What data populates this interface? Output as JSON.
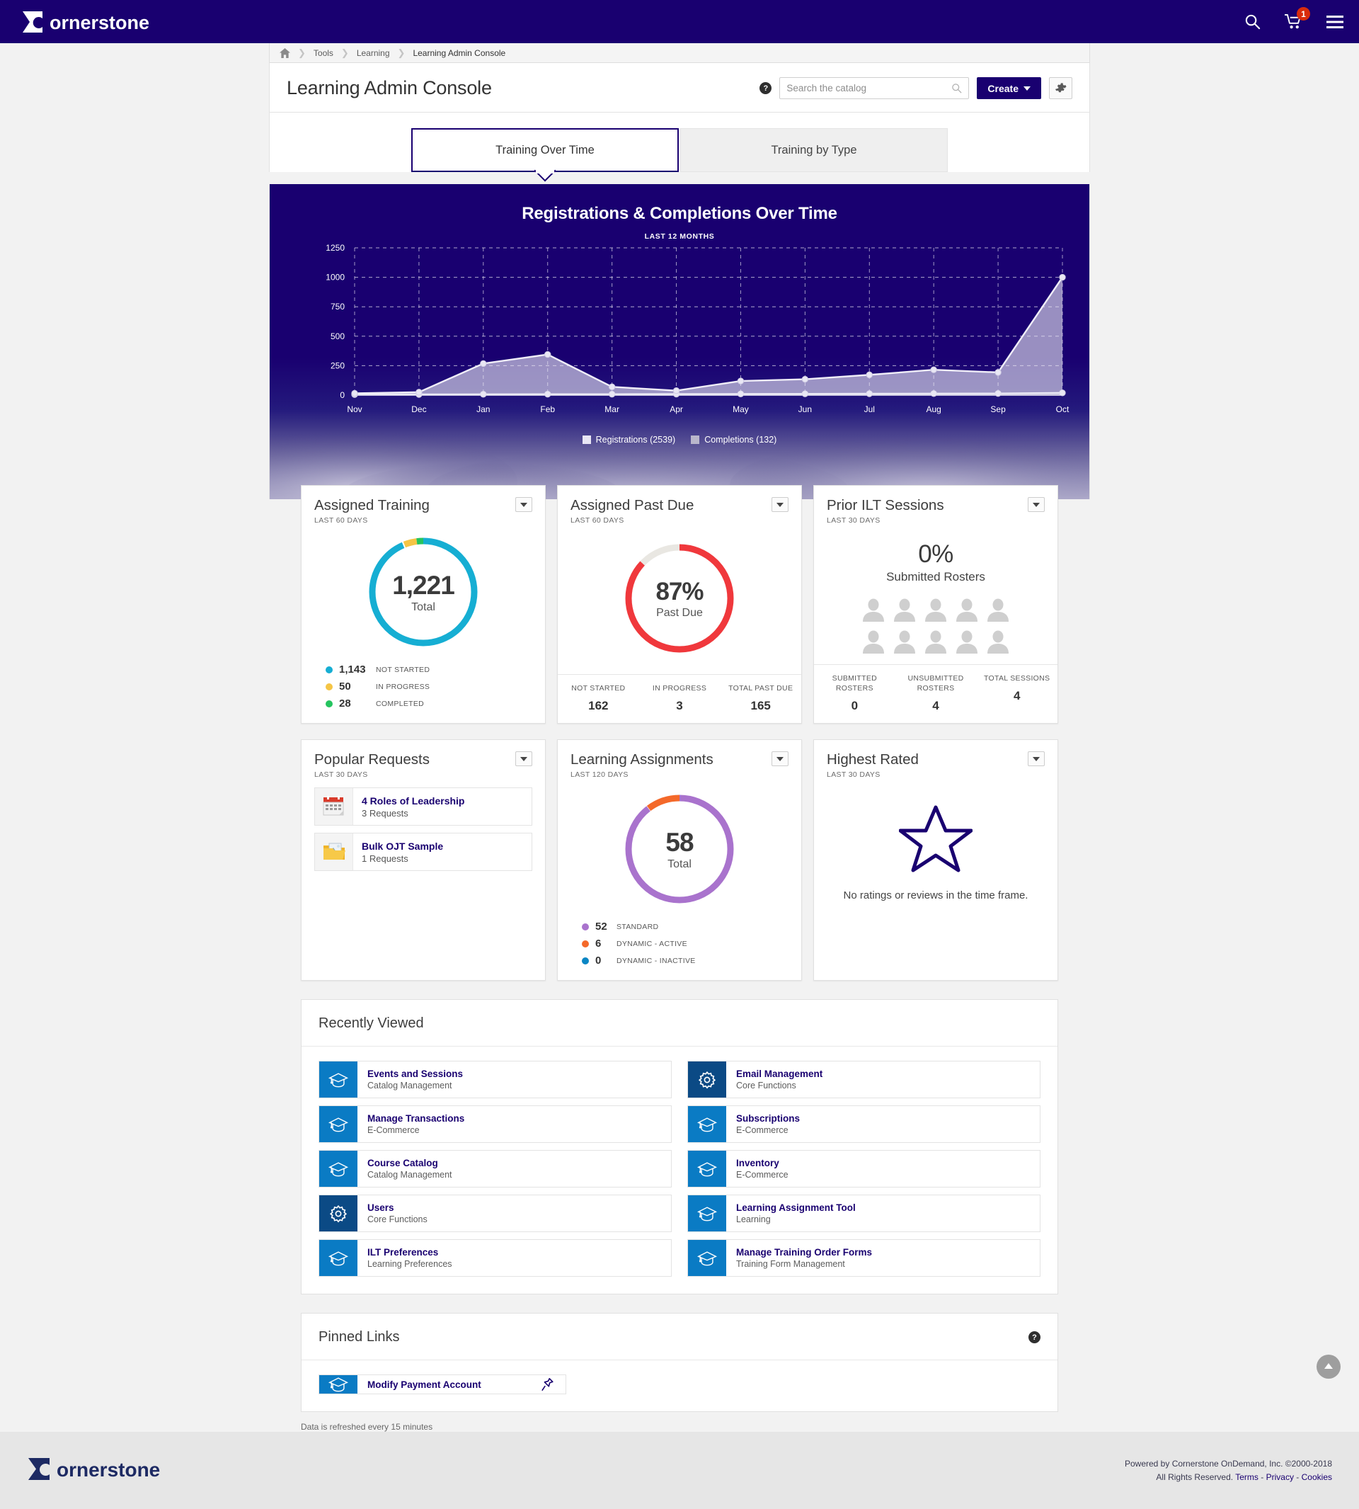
{
  "topnav": {
    "brand": "cornerstone",
    "icons": [
      {
        "name": "search-icon",
        "label": "Search"
      },
      {
        "name": "cart-icon",
        "label": "Cart",
        "badge": "1"
      },
      {
        "name": "hamburger-menu-icon",
        "label": "Menu"
      }
    ]
  },
  "breadcrumb": {
    "home": "Home",
    "items": [
      "Tools",
      "Learning",
      "Learning Admin Console"
    ]
  },
  "header": {
    "title": "Learning Admin Console",
    "help_tooltip": "?",
    "search_placeholder": "Search the catalog",
    "search_value": "",
    "create_label": "Create",
    "gear_label": "Settings"
  },
  "tabs": [
    {
      "label": "Training Over Time",
      "active": true
    },
    {
      "label": "Training by Type",
      "active": false
    }
  ],
  "chart_data": {
    "type": "area",
    "title": "Registrations & Completions Over Time",
    "subtitle": "LAST 12 MONTHS",
    "categories": [
      "Nov",
      "Dec",
      "Jan",
      "Feb",
      "Mar",
      "Apr",
      "May",
      "Jun",
      "Jul",
      "Aug",
      "Sep",
      "Oct"
    ],
    "series": [
      {
        "name": "Registrations (2539)",
        "color": "#e8e6f4",
        "values": [
          15,
          25,
          268,
          345,
          70,
          38,
          120,
          135,
          172,
          215,
          193,
          1000
        ]
      },
      {
        "name": "Completions (132)",
        "color": "#b9b6cb",
        "values": [
          5,
          6,
          7,
          8,
          8,
          9,
          10,
          11,
          12,
          13,
          14,
          19
        ]
      }
    ],
    "ylim": [
      0,
      1250
    ],
    "yticks": [
      0,
      250,
      500,
      750,
      1000,
      1250
    ],
    "xlabel": "",
    "ylabel": "",
    "grid": true,
    "legend_position": "bottom",
    "legend": [
      "Registrations (2539)",
      "Completions (132)"
    ]
  },
  "widgets": {
    "assigned_training": {
      "title": "Assigned Training",
      "period": "LAST 60 DAYS",
      "total_value": "1,221",
      "total_label": "Total",
      "segments": [
        {
          "label": "NOT STARTED",
          "value": "1,143",
          "number": 1143,
          "color": "#16aed3"
        },
        {
          "label": "IN PROGRESS",
          "value": "50",
          "number": 50,
          "color": "#f5c545"
        },
        {
          "label": "COMPLETED",
          "value": "28",
          "number": 28,
          "color": "#25c45f"
        }
      ]
    },
    "assigned_past_due": {
      "title": "Assigned Past Due",
      "period": "LAST 60 DAYS",
      "pct_value": "87%",
      "pct_label": "Past Due",
      "pct_number": 87,
      "arc_color": "#f0383c",
      "track_color": "#e9e7e2",
      "stats": [
        {
          "label": "NOT STARTED",
          "value": "162"
        },
        {
          "label": "IN PROGRESS",
          "value": "3"
        },
        {
          "label": "TOTAL PAST DUE",
          "value": "165"
        }
      ]
    },
    "prior_ilt_sessions": {
      "title": "Prior ILT Sessions",
      "period": "LAST 30 DAYS",
      "pct_value": "0%",
      "pct_label": "Submitted Rosters",
      "people_count": 10,
      "stats": [
        {
          "label": "SUBMITTED ROSTERS",
          "value": "0"
        },
        {
          "label": "UNSUBMITTED ROSTERS",
          "value": "4"
        },
        {
          "label": "TOTAL SESSIONS",
          "value": "4"
        }
      ]
    },
    "popular_requests": {
      "title": "Popular Requests",
      "period": "LAST 30 DAYS",
      "items": [
        {
          "name": "4 Roles of Leadership",
          "count": "3 Requests",
          "icon": "calendar-icon"
        },
        {
          "name": "Bulk OJT Sample",
          "count": "1 Requests",
          "icon": "folder-image-icon"
        }
      ]
    },
    "learning_assignments": {
      "title": "Learning Assignments",
      "period": "LAST 120 DAYS",
      "total_value": "58",
      "total_label": "Total",
      "segments": [
        {
          "label": "STANDARD",
          "value": "52",
          "number": 52,
          "color": "#a973cd"
        },
        {
          "label": "DYNAMIC - ACTIVE",
          "value": "6",
          "number": 6,
          "color": "#f4692a"
        },
        {
          "label": "DYNAMIC - INACTIVE",
          "value": "0",
          "number": 0,
          "color": "#0a86c4"
        }
      ]
    },
    "highest_rated": {
      "title": "Highest Rated",
      "period": "LAST 30 DAYS",
      "empty_message": "No ratings or reviews in the time frame.",
      "icon": "star-outline-icon"
    }
  },
  "recently_viewed": {
    "title": "Recently Viewed",
    "items": [
      {
        "name": "Events and Sessions",
        "category": "Catalog Management",
        "icon": "graduation-cap-icon",
        "tone": "blue"
      },
      {
        "name": "Email Management",
        "category": "Core Functions",
        "icon": "gear-icon",
        "tone": "navy"
      },
      {
        "name": "Manage Transactions",
        "category": "E-Commerce",
        "icon": "graduation-cap-icon",
        "tone": "blue"
      },
      {
        "name": "Subscriptions",
        "category": "E-Commerce",
        "icon": "graduation-cap-icon",
        "tone": "blue"
      },
      {
        "name": "Course Catalog",
        "category": "Catalog Management",
        "icon": "graduation-cap-icon",
        "tone": "blue"
      },
      {
        "name": "Inventory",
        "category": "E-Commerce",
        "icon": "graduation-cap-icon",
        "tone": "blue"
      },
      {
        "name": "Users",
        "category": "Core Functions",
        "icon": "gear-icon",
        "tone": "navy"
      },
      {
        "name": "Learning Assignment Tool",
        "category": "Learning",
        "icon": "graduation-cap-icon",
        "tone": "blue"
      },
      {
        "name": "ILT Preferences",
        "category": "Learning Preferences",
        "icon": "graduation-cap-icon",
        "tone": "blue"
      },
      {
        "name": "Manage Training Order Forms",
        "category": "Training Form Management",
        "icon": "graduation-cap-icon",
        "tone": "blue"
      }
    ]
  },
  "pinned_links": {
    "title": "Pinned Links",
    "help_tooltip": "?",
    "items": [
      {
        "name": "Modify Payment Account",
        "icon": "graduation-cap-icon",
        "pin_icon": "pin-icon"
      }
    ]
  },
  "refresh_note": "Data is refreshed every 15 minutes",
  "footer": {
    "brand": "cornerstone",
    "powered_by": "Powered by Cornerstone OnDemand, Inc. ©2000-2018",
    "rights_prefix": "All Rights Reserved.",
    "terms": "Terms",
    "privacy": "Privacy",
    "cookies": "Cookies"
  },
  "scroll_top_label": "Back to top"
}
